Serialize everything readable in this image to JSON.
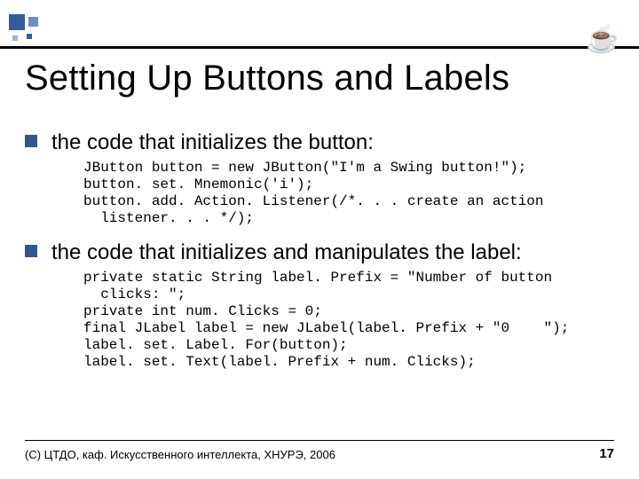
{
  "slide": {
    "title": "Setting Up Buttons and Labels",
    "bullets": [
      {
        "text": "the code that initializes the button:",
        "code": "JButton button = new JButton(\"I'm a Swing button!\");\nbutton. set. Mnemonic('i');\nbutton. add. Action. Listener(/*. . . create an action\n  listener. . . */);"
      },
      {
        "text": "the code that initializes and manipulates the label:",
        "code": "private static String label. Prefix = \"Number of button\n  clicks: \";\nprivate int num. Clicks = 0;\nfinal JLabel label = new JLabel(label. Prefix + \"0    \");\nlabel. set. Label. For(button);\nlabel. set. Text(label. Prefix + num. Clicks);"
      }
    ],
    "logo_glyph": "☕",
    "footer": {
      "copyright": "(С) ЦТДО, каф. Искусственного интеллекта, ХНУРЭ, 2006",
      "page": "17"
    }
  }
}
